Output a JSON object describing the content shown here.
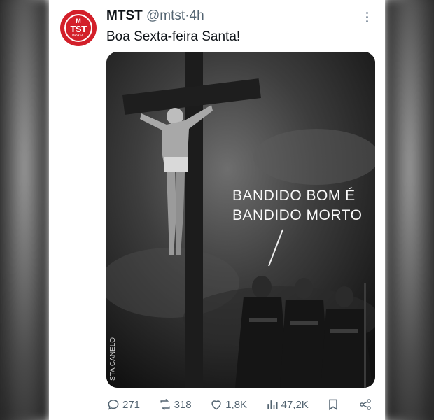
{
  "account": {
    "name": "MTST",
    "handle": "@mtst",
    "separator": "·",
    "time": "4h",
    "avatar_text": "MTST",
    "avatar_sub": "BRASIL",
    "avatar_color": "#d3202a"
  },
  "tweet": {
    "text": "Boa Sexta-feira Santa!"
  },
  "media": {
    "speech_line1": "BANDIDO BOM É",
    "speech_line2": "BANDIDO MORTO",
    "signature": "STA CANELO"
  },
  "actions": {
    "replies": "271",
    "reposts": "318",
    "likes": "1,8K",
    "views": "47,2K"
  },
  "icons": [
    "more-icon",
    "reply-icon",
    "repost-icon",
    "like-icon",
    "views-icon",
    "bookmark-icon",
    "share-icon"
  ]
}
